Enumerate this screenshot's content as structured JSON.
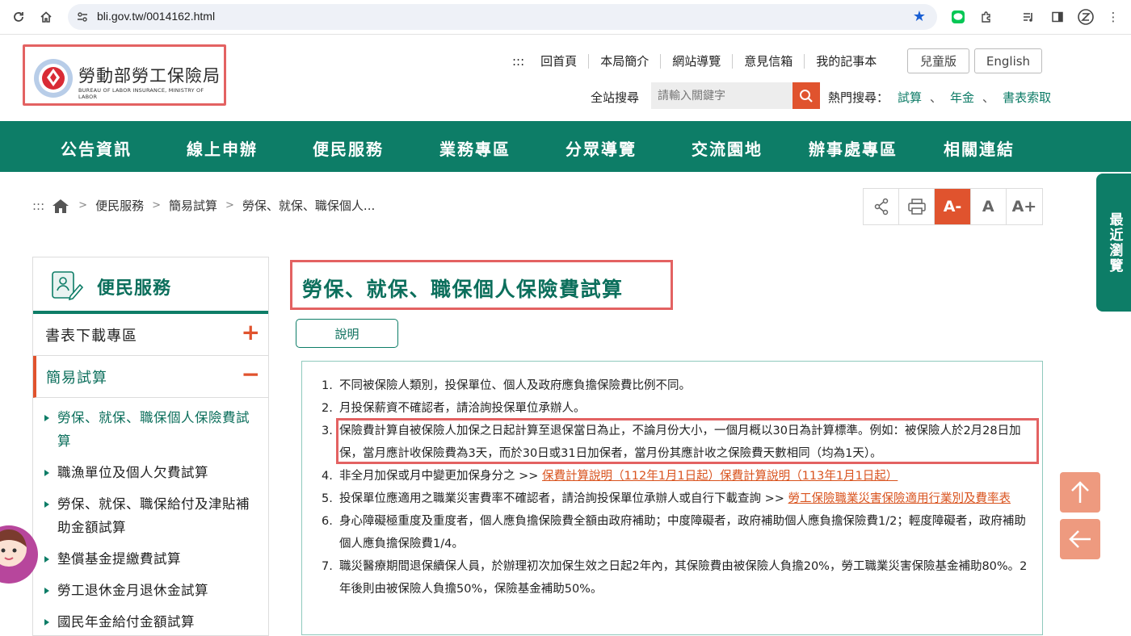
{
  "browser": {
    "url": "bli.gov.tw/0014162.html"
  },
  "header": {
    "logo_cn": "勞動部勞工保險局",
    "logo_en": "BUREAU OF LABOR INSURANCE, MINISTRY OF LABOR",
    "topnav": [
      ":::",
      "回首頁",
      "本局簡介",
      "網站導覽",
      "意見信箱",
      "我的記事本"
    ],
    "kids_label": "兒童版",
    "english_label": "English",
    "search_label": "全站搜尋",
    "search_placeholder": "請輸入關鍵字",
    "hot_label": "熱門搜尋：",
    "hot_links": [
      "試算",
      "年金",
      "書表索取"
    ],
    "hot_sep": "、"
  },
  "mainnav": [
    "公告資訊",
    "線上申辦",
    "便民服務",
    "業務專區",
    "分眾導覽",
    "交流園地",
    "辦事處專區",
    "相關連結"
  ],
  "breadcrumb": {
    "prefix": ":::",
    "items": [
      "便民服務",
      "簡易試算",
      "勞保、就保、職保個人..."
    ]
  },
  "toolbar": {
    "font_small": "A-",
    "font_mid": "A",
    "font_large": "A+"
  },
  "recent_tab": "最近瀏覽",
  "sidebar": {
    "title": "便民服務",
    "sections": [
      {
        "label": "書表下載專區",
        "toggle": "+"
      },
      {
        "label": "簡易試算",
        "toggle": "−"
      }
    ],
    "sub_items": [
      "勞保、就保、職保個人保險費試算",
      "職漁單位及個人欠費試算",
      "勞保、就保、職保給付及津貼補助金額試算",
      "墊償基金提繳費試算",
      "勞工退休金月退休金試算",
      "國民年金給付金額試算"
    ]
  },
  "avatar_label": "客服",
  "content": {
    "title": "勞保、就保、職保個人保險費試算",
    "explain_label": "說明",
    "notes": [
      {
        "n": "1.",
        "text": "不同被保險人類別，投保單位、個人及政府應負擔保險費比例不同。"
      },
      {
        "n": "2.",
        "text": "月投保薪資不確認者，請洽詢投保單位承辦人。"
      },
      {
        "n": "3.",
        "text": "保險費計算自被保險人加保之日起計算至退保當日為止，不論月份大小，一個月概以30日為計算標準。例如：被保險人於2月28日加保，當月應計收保險費為3天，而於30日或31日加保者，當月份其應計收之保險費天數相同（均為1天）。"
      },
      {
        "n": "4.",
        "text": "非全月加保或月中變更加保身分之 >> ",
        "link1": "保費計算說明（112年1月1日起）",
        "link2": "保費計算說明（113年1月1日起）"
      },
      {
        "n": "5.",
        "text": "投保單位應適用之職業災害費率不確認者，請洽詢投保單位承辦人或自行下載查詢 >> ",
        "link1": "勞工保險職業災害保險適用行業別及費率表"
      },
      {
        "n": "6.",
        "text": "身心障礙極重度及重度者，個人應負擔保險費全額由政府補助；中度障礙者，政府補助個人應負擔保險費1/2；輕度障礙者，政府補助個人應負擔保險費1/4。"
      },
      {
        "n": "7.",
        "text": "職災醫療期間退保續保人員，於辦理初次加保生效之日起2年內，其保險費由被保險人負擔20%，勞工職業災害保險基金補助80%。2年後則由被保險人負擔50%，保險基金補助50%。"
      }
    ]
  },
  "colors": {
    "brand_green": "#0d7d67",
    "accent_orange": "#e0532e",
    "highlight_red": "#e36262"
  }
}
